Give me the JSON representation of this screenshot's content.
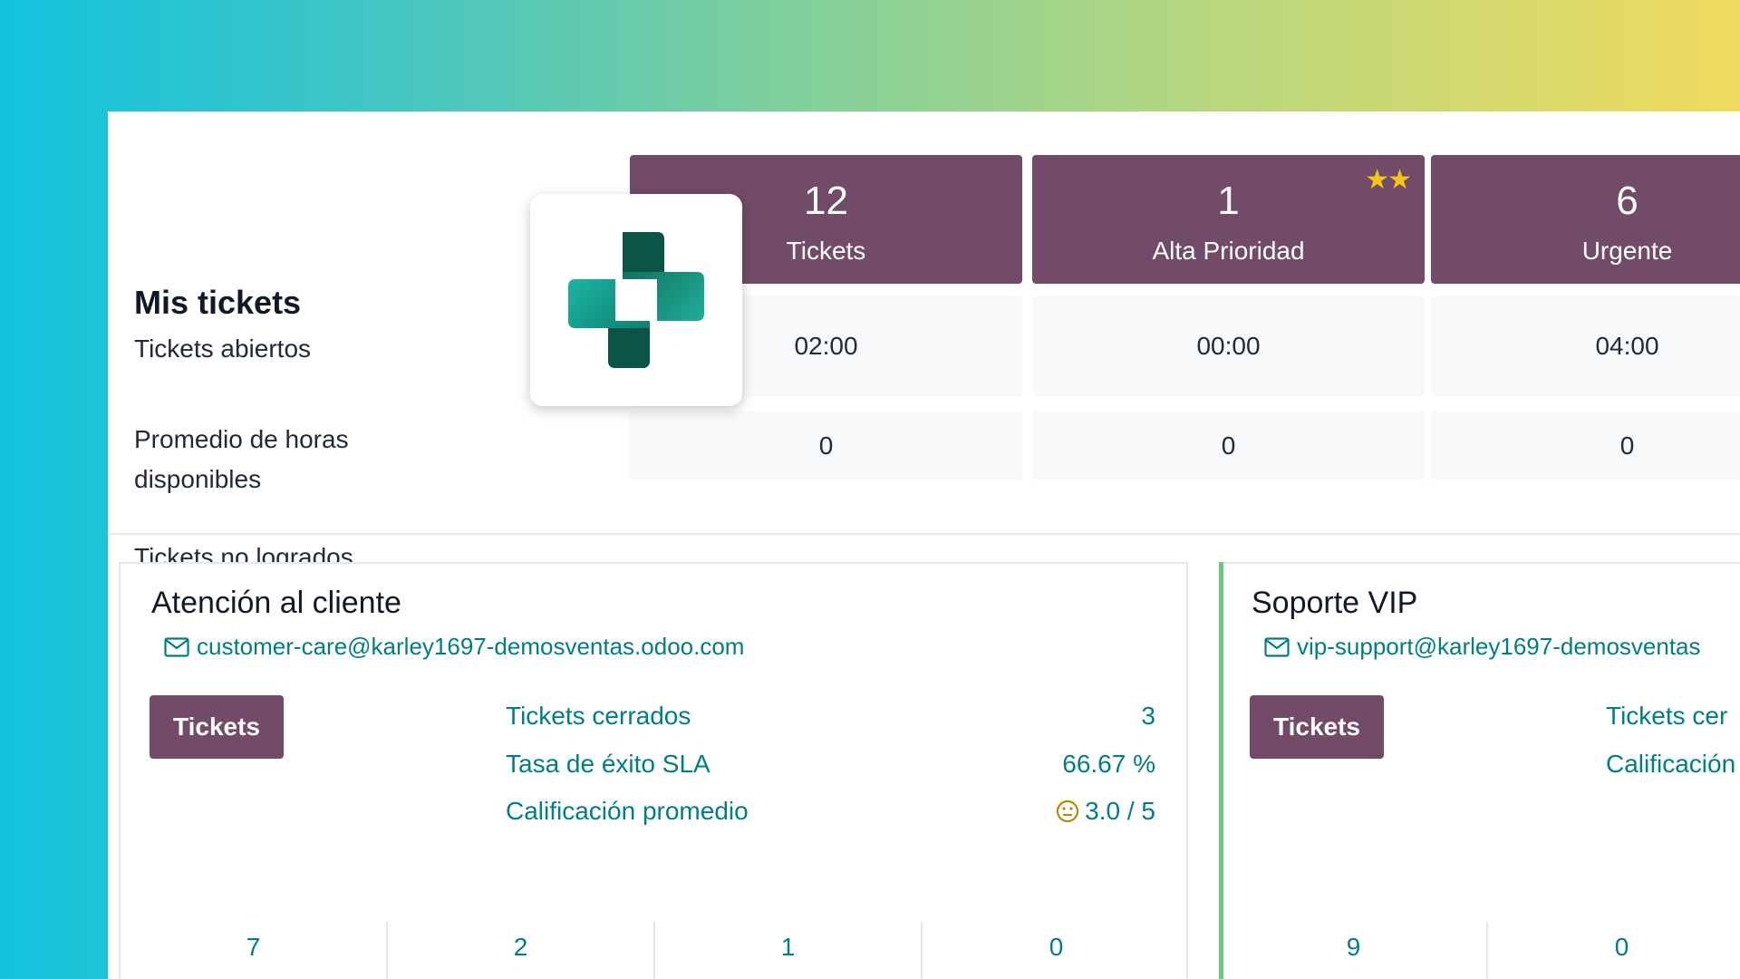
{
  "summary": {
    "title": "Mis tickets",
    "row_labels": {
      "open": "Tickets abiertos",
      "hours_line1": "Promedio de horas",
      "hours_line2": "disponibles",
      "failed": "Tickets no logrados"
    },
    "columns": [
      {
        "count": "12",
        "label": "Tickets",
        "stars": "",
        "hours": "02:00",
        "failed": "0"
      },
      {
        "count": "1",
        "label": "Alta Prioridad",
        "stars": "★★",
        "hours": "00:00",
        "failed": "0"
      },
      {
        "count": "6",
        "label": "Urgente",
        "stars": "★★★",
        "hours": "04:00",
        "failed": "0"
      }
    ]
  },
  "teams": [
    {
      "name": "Atención al cliente",
      "email": "customer-care@karley1697-demosventas.odoo.com",
      "button": "Tickets",
      "metrics": [
        {
          "label": "Tickets cerrados",
          "value": "3"
        },
        {
          "label": "Tasa de éxito SLA",
          "value": "66.67 %"
        },
        {
          "label": "Calificación promedio",
          "value": "3.0 / 5"
        }
      ],
      "counts": [
        "7",
        "2",
        "1",
        "0"
      ]
    },
    {
      "name": "Soporte VIP",
      "email": "vip-support@karley1697-demosventas",
      "button": "Tickets",
      "metrics": [
        {
          "label": "Tickets cer",
          "value": ""
        },
        {
          "label": "Calificación",
          "value": ""
        }
      ],
      "counts": [
        "9",
        "0"
      ]
    }
  ],
  "icons": {
    "logo": "helpdesk-cross-logo",
    "email": "envelope-icon",
    "rating": "neutral-face-icon"
  },
  "colors": {
    "brand": "#714b67",
    "link": "#017e84",
    "star": "#f5c518",
    "vip_accent": "#6cc57c"
  }
}
